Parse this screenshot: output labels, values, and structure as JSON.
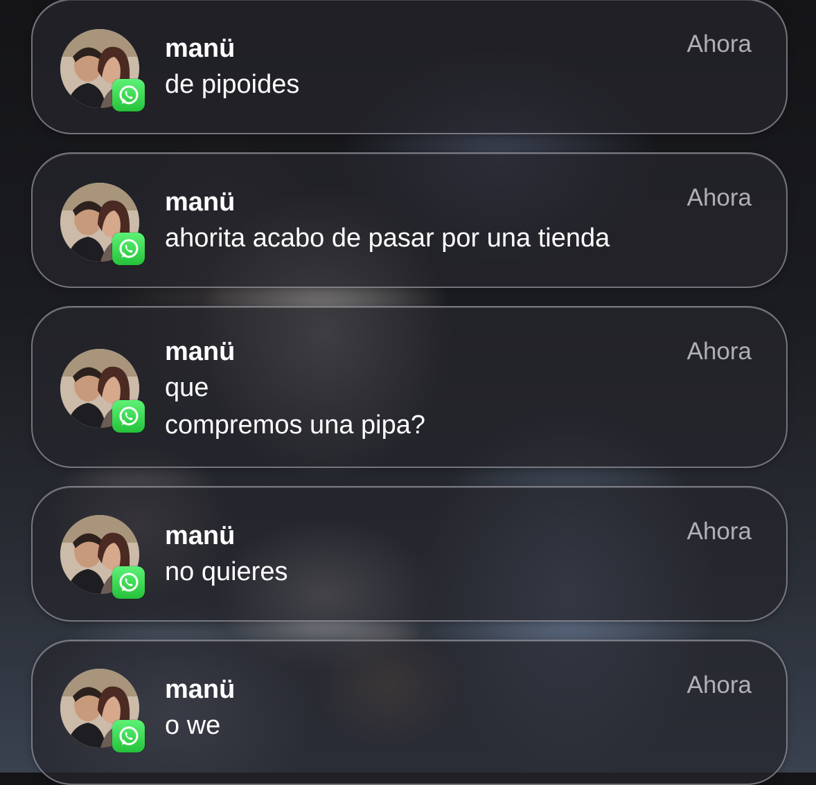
{
  "notifications": [
    {
      "sender": "manü",
      "time": "Ahora",
      "lines": [
        "de pipoides"
      ]
    },
    {
      "sender": "manü",
      "time": "Ahora",
      "lines": [
        "ahorita acabo de pasar por una tienda"
      ]
    },
    {
      "sender": "manü",
      "time": "Ahora",
      "lines": [
        "que",
        "compremos una pipa?"
      ]
    },
    {
      "sender": "manü",
      "time": "Ahora",
      "lines": [
        "no quieres"
      ]
    },
    {
      "sender": "manü",
      "time": "Ahora",
      "lines": [
        "o we"
      ]
    }
  ],
  "app_icon": "whatsapp-icon",
  "colors": {
    "badge_green": "#25c23a",
    "card_bg": "#26262c",
    "text": "#ffffff",
    "time_text": "#d7d7de"
  }
}
